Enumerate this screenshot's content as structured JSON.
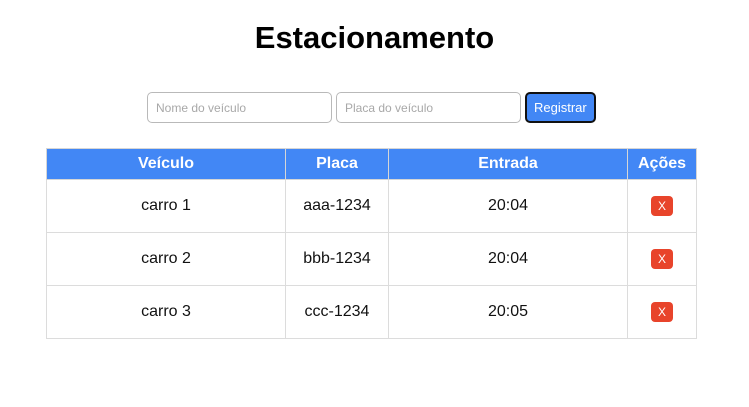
{
  "page": {
    "title": "Estacionamento"
  },
  "form": {
    "name_placeholder": "Nome do veículo",
    "name_value": "",
    "plate_placeholder": "Placa do veículo",
    "plate_value": "",
    "submit_label": "Registrar"
  },
  "table": {
    "headers": [
      "Veículo",
      "Placa",
      "Entrada",
      "Ações"
    ],
    "rows": [
      {
        "vehicle": "carro 1",
        "plate": "aaa-1234",
        "entry": "20:04",
        "action_label": "X"
      },
      {
        "vehicle": "carro 2",
        "plate": "bbb-1234",
        "entry": "20:04",
        "action_label": "X"
      },
      {
        "vehicle": "carro 3",
        "plate": "ccc-1234",
        "entry": "20:05",
        "action_label": "X"
      }
    ]
  },
  "colors": {
    "accent": "#4287f5",
    "delete": "#e8442b"
  }
}
